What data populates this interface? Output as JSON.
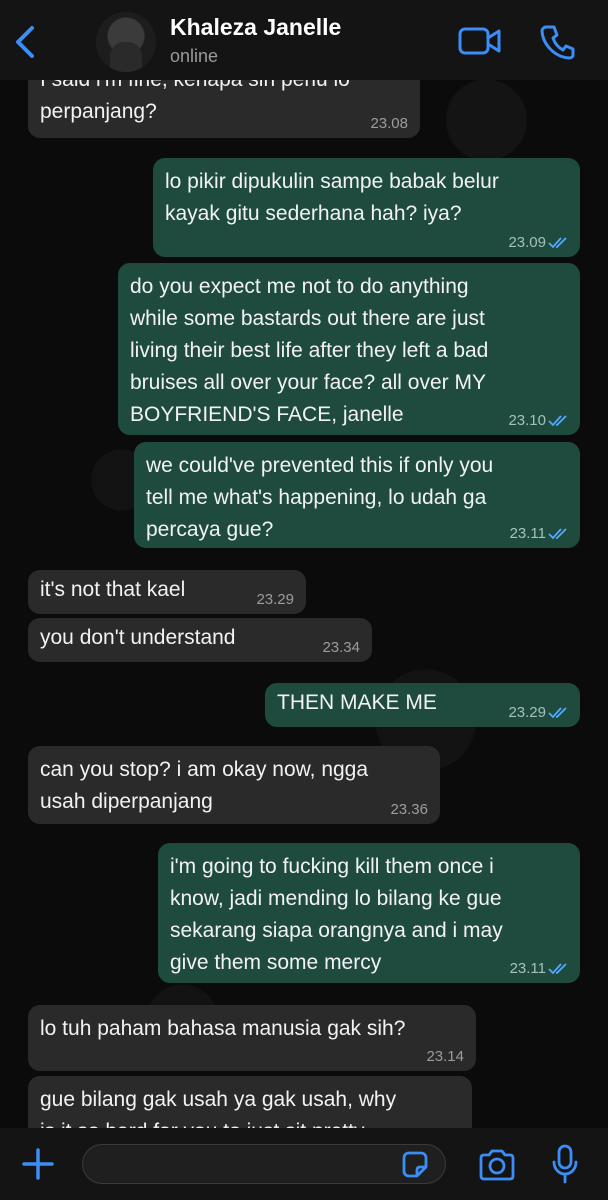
{
  "header": {
    "contact_name": "Khaleza Janelle",
    "status": "online"
  },
  "messages": [
    {
      "dir": "in",
      "text": "I said i'm fine, kenapa sih perlu lo\nperpanjang?",
      "time": "23.08"
    },
    {
      "dir": "out",
      "text": "lo pikir dipukulin sampe babak belur\nkayak gitu sederhana hah? iya?",
      "time": "23.09",
      "read": true
    },
    {
      "dir": "out",
      "text": "do you expect me not to do anything\nwhile some bastards out there are just\nliving their best life after they left a bad\nbruises all over your face? all over MY\nBOYFRIEND'S FACE, janelle",
      "time": "23.10",
      "read": true
    },
    {
      "dir": "out",
      "text": "we could've prevented this if only you\ntell me what's happening, lo udah ga\npercaya gue?",
      "time": "23.11",
      "read": true
    },
    {
      "dir": "in",
      "text": "it's not that kael",
      "time": "23.29"
    },
    {
      "dir": "in",
      "text": "you don't understand",
      "time": "23.34"
    },
    {
      "dir": "out",
      "text": "THEN MAKE ME",
      "time": "23.29",
      "read": true
    },
    {
      "dir": "in",
      "text": "can you stop? i am okay now, ngga\nusah diperpanjang",
      "time": "23.36"
    },
    {
      "dir": "out",
      "text": "i'm going to fucking kill them once i\nknow, jadi mending lo bilang ke gue\nsekarang siapa orangnya and i may\ngive them some mercy",
      "time": "23.11",
      "read": true
    },
    {
      "dir": "in",
      "text": "lo tuh paham bahasa manusia gak sih?",
      "time": "23.14"
    },
    {
      "dir": "in",
      "text": "gue bilang gak usah ya gak usah, why\nis it so hard for you to just sit pretty",
      "time": ""
    }
  ],
  "input": {
    "placeholder": ""
  },
  "colors": {
    "accent": "#3a8ef6",
    "outgoing_bubble": "#1f4b3f",
    "incoming_bubble": "#2a2a2a",
    "read_check": "#53a9ff"
  },
  "icons": {
    "back": "chevron-left-icon",
    "video": "video-camera-icon",
    "call": "phone-icon",
    "add": "plus-icon",
    "sticker": "sticker-icon",
    "camera": "camera-icon",
    "mic": "microphone-icon"
  }
}
